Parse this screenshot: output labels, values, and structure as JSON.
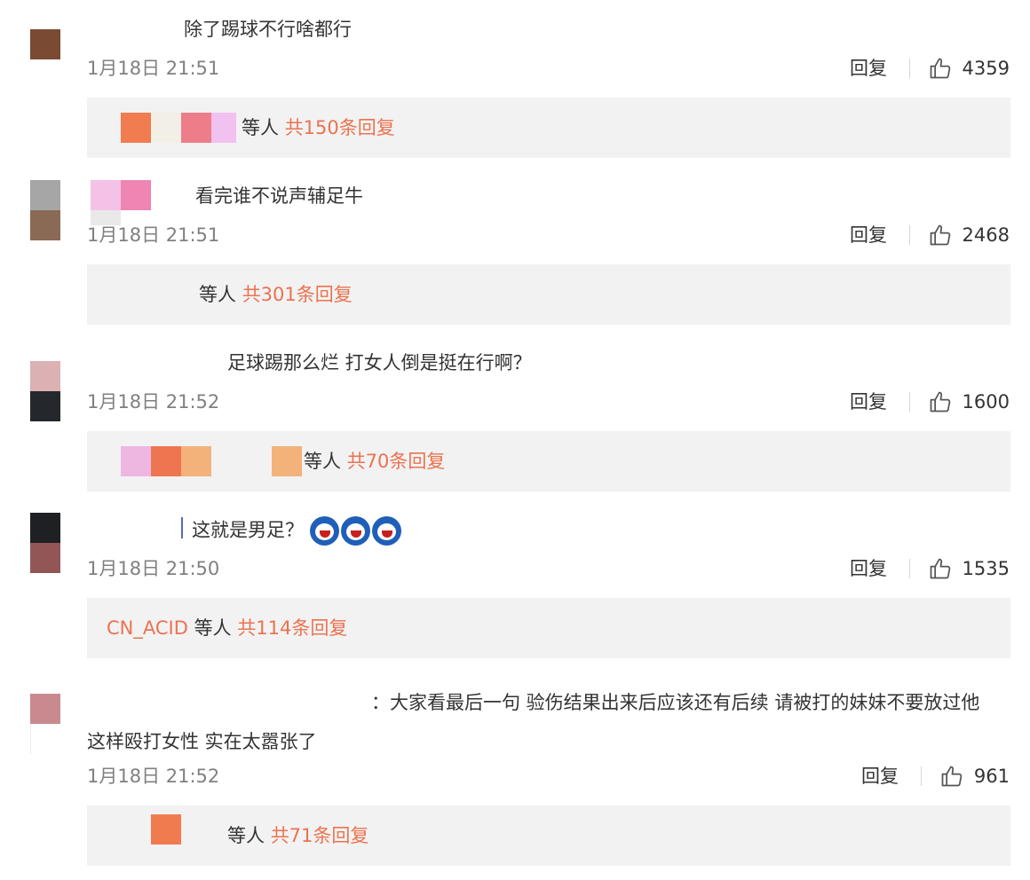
{
  "comments": [
    {
      "text": "除了踢球不行啥都行",
      "timestamp": "1月18日 21:51",
      "reply_label": "回复",
      "likes": "4359",
      "replies": {
        "suffix": "等人",
        "count_link": "共150条回复"
      }
    },
    {
      "text": "看完谁不说声辅足牛",
      "timestamp": "1月18日 21:51",
      "reply_label": "回复",
      "likes": "2468",
      "replies": {
        "suffix": "等人",
        "count_link": "共301条回复"
      }
    },
    {
      "text": "足球踢那么烂 打女人倒是挺在行啊？",
      "timestamp": "1月18日 21:52",
      "reply_label": "回复",
      "likes": "1600",
      "replies": {
        "suffix": "等人",
        "count_link": "共70条回复"
      }
    },
    {
      "text": "这就是男足？",
      "timestamp": "1月18日 21:50",
      "reply_label": "回复",
      "likes": "1535",
      "replies": {
        "name": "CN_ACID",
        "suffix": "等人",
        "count_link": "共114条回复"
      }
    },
    {
      "text": "：大家看最后一句 验伤结果出来后应该还有后续 请被打的妹妹不要放过他 这样殴打女性 实在太嚣张了",
      "timestamp": "1月18日 21:52",
      "reply_label": "回复",
      "likes": "961",
      "replies": {
        "suffix": "等人",
        "count_link": "共71条回复"
      }
    }
  ],
  "icons": {
    "like": "thumbs-up-icon",
    "emoji": "crying-face-emoji-icon"
  },
  "colors": {
    "link": "#eb7350",
    "timestamp": "#808080",
    "reply_box": "#f2f2f2"
  }
}
